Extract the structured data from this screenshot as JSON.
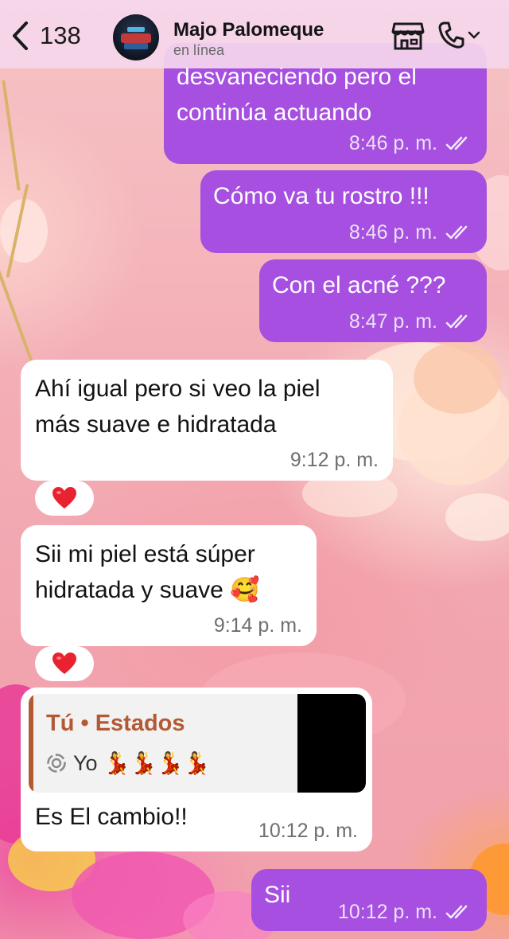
{
  "header": {
    "back_count": "138",
    "contact_name": "Majo Palomeque",
    "contact_status": "en línea"
  },
  "messages": [
    {
      "direction": "outgoing",
      "text": "desvaneciendo pero el\ncontinúa actuando",
      "time": "8:46 p. m.",
      "read": true
    },
    {
      "direction": "outgoing",
      "text": "Cómo va tu rostro !!!",
      "time": "8:46 p. m.",
      "read": true
    },
    {
      "direction": "outgoing",
      "text": "Con el acné ???",
      "time": "8:47 p. m.",
      "read": true
    },
    {
      "direction": "incoming",
      "text": "Ahí igual pero si veo la piel\nmás suave e hidratada",
      "time": "9:12 p. m.",
      "reaction": "❤️"
    },
    {
      "direction": "incoming",
      "text": "Sii mi piel está súper\nhidratada y suave 🥰",
      "time": "9:14 p. m.",
      "reaction": "❤️"
    },
    {
      "direction": "incoming",
      "quote": {
        "author": "Tú • Estados",
        "text": "Yo 💃💃💃💃"
      },
      "text": "Es El cambio!!",
      "time": "10:12 p. m."
    },
    {
      "direction": "outgoing",
      "text": "Sii",
      "time": "10:12 p. m.",
      "read": true
    }
  ],
  "colors": {
    "outgoing_bubble": "#a64fe0",
    "incoming_bubble": "#ffffff",
    "quote_accent": "#b35a34",
    "header_bg": "#f5d7eb"
  },
  "icons": {
    "back": "chevron-left-icon",
    "shop": "storefront-icon",
    "call": "phone-icon",
    "call_menu": "chevron-down-icon",
    "read_receipt": "double-check-icon",
    "reaction": "heart-icon",
    "status_quote": "status-ring-icon"
  }
}
